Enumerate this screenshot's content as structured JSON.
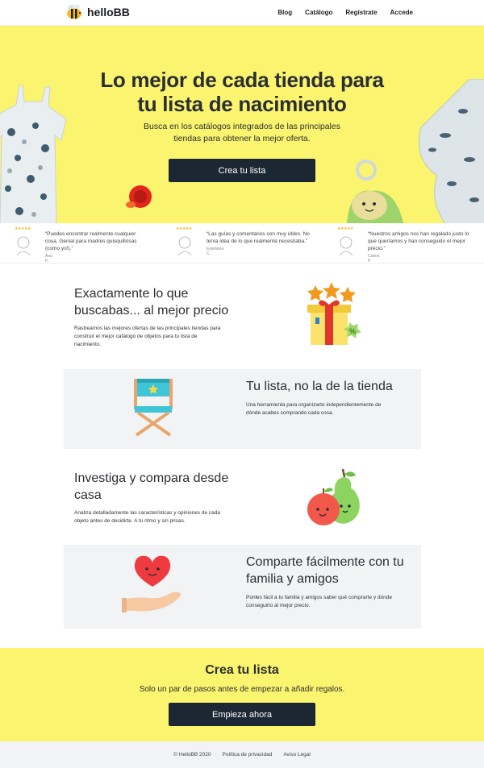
{
  "header": {
    "logo_text": "helloBB",
    "nav": [
      "Blog",
      "Catálogo",
      "Regístrate",
      "Accede"
    ]
  },
  "hero": {
    "title_line1": "Lo mejor de cada tienda para",
    "title_line2": "tu lista de nacimiento",
    "subtitle_line1": "Busca en los catálogos integrados de las principales",
    "subtitle_line2": "tiendas para obtener la mejor oferta.",
    "cta_label": "Crea tu lista"
  },
  "testimonials": [
    {
      "stars": "★★★★★",
      "quote_lines": [
        "“Puedes encontrar realmente cualquier",
        "cosa. Genial para madres quisquillosas",
        "(como yo!).”"
      ],
      "author": "Ana P."
    },
    {
      "stars": "★★★★★",
      "quote_lines": [
        "“Las guías y comentarios son muy útiles. No",
        "tenía idea de lo que realmente necesitaba.”"
      ],
      "author": "Estefanía C."
    },
    {
      "stars": "★★★★★",
      "quote_lines": [
        "“Nuestros amigos nos han regalado justo lo",
        "que queríamos y han conseguido el mejor",
        "precio.”"
      ],
      "author": "Carlos P."
    }
  ],
  "features": [
    {
      "title_lines": [
        "Exactamente lo que",
        "buscabas... al mejor precio"
      ],
      "text_lines": [
        "Rastreamos las mejores ofertas de las principales tiendas para",
        "construir el mejor catálogo de objetos para tu lista de",
        "nacimiento."
      ],
      "icon": "gift-icon"
    },
    {
      "title_lines": [
        "Tu lista, no la de la tienda"
      ],
      "text_lines": [
        "Una herramienta para organizarte independientemente de",
        "dónde acabes comprando cada cosa."
      ],
      "icon": "director-chair-icon"
    },
    {
      "title_lines": [
        "Investiga y compara desde",
        "casa"
      ],
      "text_lines": [
        "Analiza detalladamente las características y opiniones de cada",
        "objeto antes de decidirte. A tu ritmo y sin prisas."
      ],
      "icon": "fruits-icon"
    },
    {
      "title_lines": [
        "Comparte fácilmente con tu",
        "familia y amigos"
      ],
      "text_lines": [
        "Ponles fácil a tu familia y amigos saber qué comprarte y dónde",
        "conseguirlo al mejor precio."
      ],
      "icon": "heart-hand-icon"
    }
  ],
  "cta": {
    "title": "Crea tu lista",
    "subtitle": "Solo un par de pasos antes de empezar a añadir regalos.",
    "button_label": "Empieza ahora"
  },
  "footer": {
    "copyright": "© HelloBB 2020",
    "links": [
      "Política de privacidad",
      "Aviso Legal"
    ]
  },
  "colors": {
    "yellow": "#fbf46e",
    "dark": "#1b2733",
    "grey_panel": "#f2f3f5"
  }
}
